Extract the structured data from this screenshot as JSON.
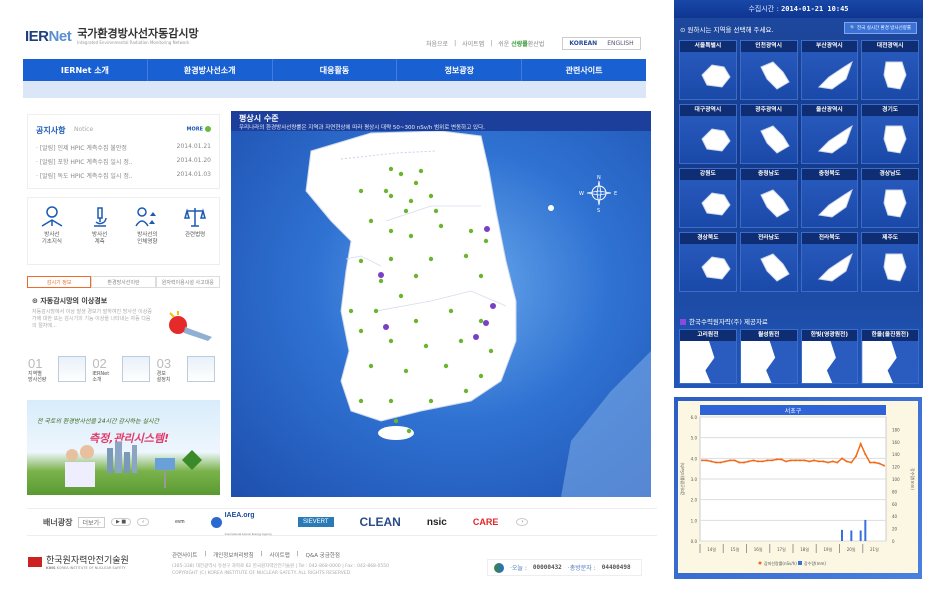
{
  "header": {
    "logo": {
      "brand_a": "IER",
      "brand_b": "Net",
      "title": "국가환경방사선자동감시망",
      "subtitle": "Integrated Environmental Radiation Monitoring Network"
    },
    "util_links": [
      "처음으로",
      "사이트맵"
    ],
    "easy_text_a": "쉬운",
    "easy_text_b": "선량률",
    "easy_text_c": "환산법",
    "lang": [
      "KOREAN",
      "ENGLISH"
    ],
    "nav": [
      "IERNet 소개",
      "환경방사선소개",
      "대응활동",
      "정보광장",
      "관련사이트"
    ]
  },
  "notice": {
    "title": "공지사항",
    "title_en": "Notice",
    "more": "MORE",
    "items": [
      {
        "text": "· [알림] 인제 HPIC 계측수집 불안정",
        "date": "2014.01.21"
      },
      {
        "text": "· [알림] 포항 HPIC 계측수집 일시 정..",
        "date": "2014.01.20"
      },
      {
        "text": "· [알림] 독도 HPIC 계측수집 일시 정..",
        "date": "2014.01.03"
      }
    ]
  },
  "quick_links": [
    {
      "icon": "reader-icon",
      "label_a": "방사선",
      "label_b": "기초지식"
    },
    {
      "icon": "microscope-icon",
      "label_a": "방사선",
      "label_b": "계측"
    },
    {
      "icon": "people-icon",
      "label_a": "방사선의",
      "label_b": "인체영향"
    },
    {
      "icon": "scale-icon",
      "label_a": "관련법령",
      "label_b": ""
    }
  ],
  "info_tabs": [
    "감시기 정보",
    "환경방사선이란",
    "원자력이용시설 사고대응"
  ],
  "alert": {
    "title": "자동감시망의 이상경보",
    "text": "자동감시망에서 이상 발생 경보가 발하여진 방사선 이상증가에 대한 또는 감시기의 기능 이상을 나타내는 자동 다음의 절차에..."
  },
  "steps": [
    {
      "num": "01",
      "label_a": "지역별",
      "label_b": "방사선량"
    },
    {
      "num": "02",
      "label_a": "IERNet",
      "label_b": "소개"
    },
    {
      "num": "03",
      "label_a": "경보",
      "label_b": "설정치"
    }
  ],
  "promo": {
    "line1": "전 국토의 환경방사선을 24시간 감시하는 실시간",
    "line2": "측정,관리시스템!"
  },
  "map": {
    "title": "평상시 수준",
    "desc": "우리나라의 환경방사선량률은 지역과 자연현상에 따라 평상시 대략 50~300 nSv/h 범위로 변동하고 있다.",
    "compass": {
      "n": "N",
      "s": "S",
      "e": "E",
      "w": "W"
    },
    "colors": {
      "station": "#6ab52e",
      "npp": "#7a3fc6",
      "land": "#ffffff",
      "sea": "#2f72d2"
    }
  },
  "banner_bar": {
    "label": "배너광장",
    "more": "더보기",
    "partners": [
      "evm",
      "IAEA.org",
      "SIEVERT",
      "CLEAN",
      "nsic",
      "CARE"
    ],
    "iaea_sub": "International Atomic Energy Agency"
  },
  "footer": {
    "org": "한국원자력안전기술원",
    "org_abbr": "KINS",
    "org_en": "KOREA INSTITUTE OF NUCLEAR SAFETY",
    "links": [
      "관련사이트",
      "개인정보처리방침",
      "사이트맵",
      "Q&A 궁금한점"
    ],
    "address": "(305-338) 대전광역시 유성구 과학로 62 한국원자력안전기술원 | Tel : 042-868-0000 | Fax : 042-868-0550",
    "copyright": "COPYRIGHT (C) KOREA INSTITUTE OF NUCLEAR SAFETY. ALL RIGHTS RESERVED",
    "today_label": "·오늘 :",
    "today_value": "00000432",
    "total_label": "·총방문자 :",
    "total_value": "04400498"
  },
  "region_panel": {
    "time_label": "수집시간 :",
    "time_value": "2014-01-21  10:45",
    "prompt": "원하시는 지역을 선택해 주세요.",
    "all_button": "전국 실시간 환경 방사선량률",
    "regions": [
      "서울특별시",
      "인천광역시",
      "부산광역시",
      "대전광역시",
      "대구광역시",
      "광주광역시",
      "울산광역시",
      "경기도",
      "강원도",
      "충청남도",
      "충청북도",
      "경상남도",
      "경상북도",
      "전라남도",
      "전라북도",
      "제주도"
    ],
    "khnp_title": "한국수력원자력(주) 제공자료",
    "plants": [
      "고리원전",
      "월성원전",
      "한빛(영광원전)",
      "한울(울진원전)"
    ]
  },
  "chart_data": {
    "type": "line",
    "title": "서초구",
    "ylabel": "감마선량률(nSv/h)",
    "y2label": "강수량(mm)",
    "ylim": [
      0.0,
      6.0
    ],
    "yticks": [
      "0.0",
      "1.0",
      "2.0",
      "3.0",
      "4.0",
      "5.0",
      "6.0"
    ],
    "y2lim": [
      0,
      200
    ],
    "y2ticks": [
      "0",
      "20",
      "40",
      "60",
      "80",
      "100",
      "120",
      "140",
      "160",
      "180"
    ],
    "categories": [
      "14일",
      "15일",
      "16일",
      "17일",
      "18일",
      "19일",
      "20일",
      "21일"
    ],
    "series": [
      {
        "name": "감마선량률(nSv/h)",
        "color": "#f06a1a",
        "type": "line",
        "values": [
          3.9,
          3.9,
          3.85,
          3.8,
          3.8,
          3.85,
          3.9,
          3.9,
          3.8,
          3.8,
          3.85,
          3.9,
          3.85,
          3.85,
          3.9,
          3.9,
          3.95,
          3.95,
          3.85,
          3.9,
          3.9,
          3.9,
          3.9,
          3.85,
          3.9,
          3.85,
          3.85,
          3.8,
          3.85,
          3.8,
          4.0,
          3.85,
          3.8,
          4.1,
          4.7,
          4.2,
          3.8,
          3.8,
          3.75,
          3.65
        ]
      },
      {
        "name": "강수량(mm)",
        "color": "#3a6fe0",
        "type": "bar",
        "values": [
          0,
          0,
          0,
          0,
          0,
          0,
          0,
          0,
          0,
          0,
          0,
          0,
          0,
          0,
          0,
          0,
          0,
          0,
          0,
          0,
          0,
          0,
          0,
          0,
          0,
          0,
          0,
          0,
          0,
          0,
          18,
          0,
          17,
          0,
          17,
          34,
          0,
          0,
          0,
          0
        ]
      }
    ]
  }
}
